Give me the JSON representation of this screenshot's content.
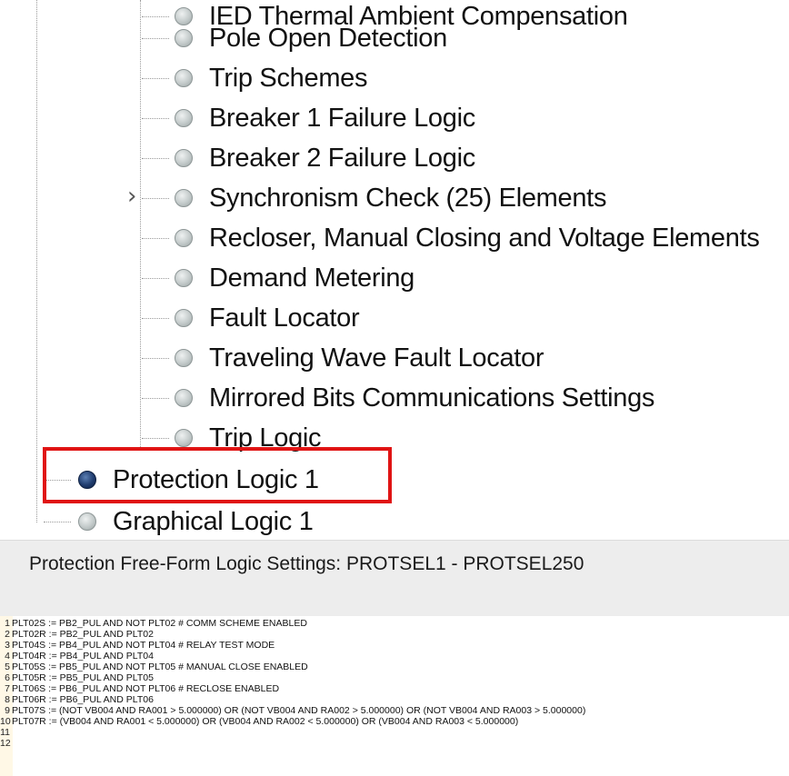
{
  "tree": {
    "items": [
      {
        "label": "IED Thermal Ambient Compensation",
        "active": false,
        "expandable": false
      },
      {
        "label": "Pole Open Detection",
        "active": false,
        "expandable": false
      },
      {
        "label": "Trip Schemes",
        "active": false,
        "expandable": false
      },
      {
        "label": "Breaker 1 Failure Logic",
        "active": false,
        "expandable": false
      },
      {
        "label": "Breaker 2 Failure Logic",
        "active": false,
        "expandable": false
      },
      {
        "label": "Synchronism Check (25) Elements",
        "active": false,
        "expandable": true
      },
      {
        "label": "Recloser, Manual Closing and Voltage Elements",
        "active": false,
        "expandable": false
      },
      {
        "label": "Demand Metering",
        "active": false,
        "expandable": false
      },
      {
        "label": "Fault Locator",
        "active": false,
        "expandable": false
      },
      {
        "label": "Traveling Wave Fault Locator",
        "active": false,
        "expandable": false
      },
      {
        "label": "Mirrored Bits Communications Settings",
        "active": false,
        "expandable": false
      },
      {
        "label": "Trip Logic",
        "active": false,
        "expandable": false
      }
    ],
    "top_items": [
      {
        "label": "Protection Logic 1",
        "active": true,
        "highlighted": true
      },
      {
        "label": "Graphical Logic 1",
        "active": false,
        "highlighted": false
      }
    ],
    "expand_icon": "chevron-right-icon",
    "highlight_color": "#e01414"
  },
  "panel": {
    "title": "Protection Free-Form Logic Settings: PROTSEL1 - PROTSEL250",
    "lines": [
      {
        "n": "1",
        "text": "PLT02S := PB2_PUL AND NOT PLT02 # COMM SCHEME ENABLED"
      },
      {
        "n": "2",
        "text": "PLT02R := PB2_PUL AND PLT02"
      },
      {
        "n": "3",
        "text": "PLT04S := PB4_PUL AND NOT PLT04 # RELAY TEST MODE"
      },
      {
        "n": "4",
        "text": "PLT04R := PB4_PUL AND PLT04"
      },
      {
        "n": "5",
        "text": "PLT05S := PB5_PUL AND NOT PLT05 # MANUAL CLOSE ENABLED"
      },
      {
        "n": "6",
        "text": "PLT05R := PB5_PUL AND PLT05"
      },
      {
        "n": "7",
        "text": "PLT06S := PB6_PUL AND NOT PLT06 # RECLOSE ENABLED"
      },
      {
        "n": "8",
        "text": "PLT06R := PB6_PUL AND PLT06"
      },
      {
        "n": "9",
        "text": "PLT07S := (NOT VB004 AND RA001 > 5.000000) OR (NOT VB004 AND RA002 > 5.000000) OR (NOT VB004 AND RA003 > 5.000000)"
      },
      {
        "n": "10",
        "text": "PLT07R := (VB004 AND RA001 < 5.000000) OR (VB004 AND RA002 < 5.000000) OR (VB004 AND RA003 < 5.000000)"
      },
      {
        "n": "11",
        "text": ""
      },
      {
        "n": "12",
        "text": ""
      }
    ]
  }
}
